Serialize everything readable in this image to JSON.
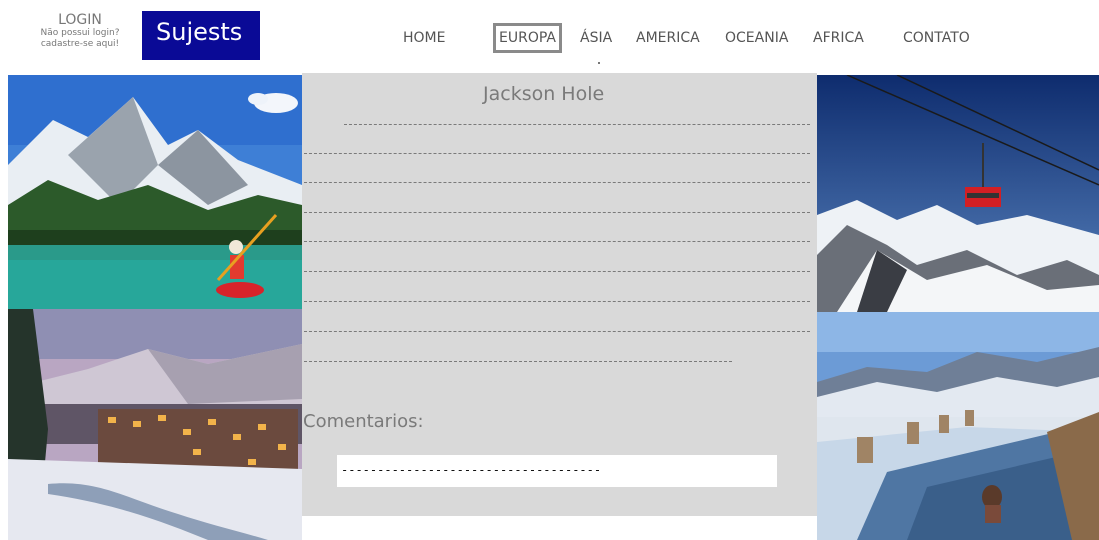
{
  "header": {
    "login_title": "LOGIN",
    "login_line1": "Não possui login?",
    "login_line2": "cadastre-se aqui!",
    "logo_text": "Sujests"
  },
  "nav": {
    "items": [
      {
        "label": "HOME"
      },
      {
        "label": "EUROPA",
        "active": true
      },
      {
        "label": "ÁSIA"
      },
      {
        "label": "AMERICA"
      },
      {
        "label": "OCEANIA"
      },
      {
        "label": "AFRICA"
      },
      {
        "label": "CONTATO"
      }
    ]
  },
  "content": {
    "title": "Jackson Hole",
    "comments_label": "Comentarios:",
    "comment_value": "------------------------------------"
  },
  "photos": [
    {
      "icon": "mountain-lake-kayak-photo"
    },
    {
      "icon": "snowy-village-photo"
    },
    {
      "icon": "aerial-tram-photo"
    },
    {
      "icon": "hot-pool-photo"
    }
  ],
  "colors": {
    "logo_bg": "#0a0a96",
    "panel_bg": "#d9d9d9",
    "text_gray": "#7a7a7a",
    "active_border": "#8a8a8a"
  }
}
